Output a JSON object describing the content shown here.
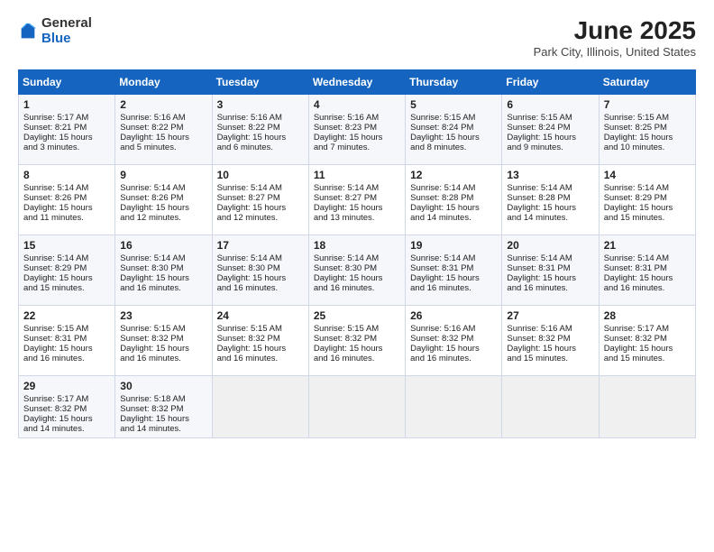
{
  "header": {
    "logo_line1": "General",
    "logo_line2": "Blue",
    "month_title": "June 2025",
    "location": "Park City, Illinois, United States"
  },
  "days_of_week": [
    "Sunday",
    "Monday",
    "Tuesday",
    "Wednesday",
    "Thursday",
    "Friday",
    "Saturday"
  ],
  "weeks": [
    [
      {
        "day": "1",
        "lines": [
          "Sunrise: 5:17 AM",
          "Sunset: 8:21 PM",
          "Daylight: 15 hours",
          "and 3 minutes."
        ]
      },
      {
        "day": "2",
        "lines": [
          "Sunrise: 5:16 AM",
          "Sunset: 8:22 PM",
          "Daylight: 15 hours",
          "and 5 minutes."
        ]
      },
      {
        "day": "3",
        "lines": [
          "Sunrise: 5:16 AM",
          "Sunset: 8:22 PM",
          "Daylight: 15 hours",
          "and 6 minutes."
        ]
      },
      {
        "day": "4",
        "lines": [
          "Sunrise: 5:16 AM",
          "Sunset: 8:23 PM",
          "Daylight: 15 hours",
          "and 7 minutes."
        ]
      },
      {
        "day": "5",
        "lines": [
          "Sunrise: 5:15 AM",
          "Sunset: 8:24 PM",
          "Daylight: 15 hours",
          "and 8 minutes."
        ]
      },
      {
        "day": "6",
        "lines": [
          "Sunrise: 5:15 AM",
          "Sunset: 8:24 PM",
          "Daylight: 15 hours",
          "and 9 minutes."
        ]
      },
      {
        "day": "7",
        "lines": [
          "Sunrise: 5:15 AM",
          "Sunset: 8:25 PM",
          "Daylight: 15 hours",
          "and 10 minutes."
        ]
      }
    ],
    [
      {
        "day": "8",
        "lines": [
          "Sunrise: 5:14 AM",
          "Sunset: 8:26 PM",
          "Daylight: 15 hours",
          "and 11 minutes."
        ]
      },
      {
        "day": "9",
        "lines": [
          "Sunrise: 5:14 AM",
          "Sunset: 8:26 PM",
          "Daylight: 15 hours",
          "and 12 minutes."
        ]
      },
      {
        "day": "10",
        "lines": [
          "Sunrise: 5:14 AM",
          "Sunset: 8:27 PM",
          "Daylight: 15 hours",
          "and 12 minutes."
        ]
      },
      {
        "day": "11",
        "lines": [
          "Sunrise: 5:14 AM",
          "Sunset: 8:27 PM",
          "Daylight: 15 hours",
          "and 13 minutes."
        ]
      },
      {
        "day": "12",
        "lines": [
          "Sunrise: 5:14 AM",
          "Sunset: 8:28 PM",
          "Daylight: 15 hours",
          "and 14 minutes."
        ]
      },
      {
        "day": "13",
        "lines": [
          "Sunrise: 5:14 AM",
          "Sunset: 8:28 PM",
          "Daylight: 15 hours",
          "and 14 minutes."
        ]
      },
      {
        "day": "14",
        "lines": [
          "Sunrise: 5:14 AM",
          "Sunset: 8:29 PM",
          "Daylight: 15 hours",
          "and 15 minutes."
        ]
      }
    ],
    [
      {
        "day": "15",
        "lines": [
          "Sunrise: 5:14 AM",
          "Sunset: 8:29 PM",
          "Daylight: 15 hours",
          "and 15 minutes."
        ]
      },
      {
        "day": "16",
        "lines": [
          "Sunrise: 5:14 AM",
          "Sunset: 8:30 PM",
          "Daylight: 15 hours",
          "and 16 minutes."
        ]
      },
      {
        "day": "17",
        "lines": [
          "Sunrise: 5:14 AM",
          "Sunset: 8:30 PM",
          "Daylight: 15 hours",
          "and 16 minutes."
        ]
      },
      {
        "day": "18",
        "lines": [
          "Sunrise: 5:14 AM",
          "Sunset: 8:30 PM",
          "Daylight: 15 hours",
          "and 16 minutes."
        ]
      },
      {
        "day": "19",
        "lines": [
          "Sunrise: 5:14 AM",
          "Sunset: 8:31 PM",
          "Daylight: 15 hours",
          "and 16 minutes."
        ]
      },
      {
        "day": "20",
        "lines": [
          "Sunrise: 5:14 AM",
          "Sunset: 8:31 PM",
          "Daylight: 15 hours",
          "and 16 minutes."
        ]
      },
      {
        "day": "21",
        "lines": [
          "Sunrise: 5:14 AM",
          "Sunset: 8:31 PM",
          "Daylight: 15 hours",
          "and 16 minutes."
        ]
      }
    ],
    [
      {
        "day": "22",
        "lines": [
          "Sunrise: 5:15 AM",
          "Sunset: 8:31 PM",
          "Daylight: 15 hours",
          "and 16 minutes."
        ]
      },
      {
        "day": "23",
        "lines": [
          "Sunrise: 5:15 AM",
          "Sunset: 8:32 PM",
          "Daylight: 15 hours",
          "and 16 minutes."
        ]
      },
      {
        "day": "24",
        "lines": [
          "Sunrise: 5:15 AM",
          "Sunset: 8:32 PM",
          "Daylight: 15 hours",
          "and 16 minutes."
        ]
      },
      {
        "day": "25",
        "lines": [
          "Sunrise: 5:15 AM",
          "Sunset: 8:32 PM",
          "Daylight: 15 hours",
          "and 16 minutes."
        ]
      },
      {
        "day": "26",
        "lines": [
          "Sunrise: 5:16 AM",
          "Sunset: 8:32 PM",
          "Daylight: 15 hours",
          "and 16 minutes."
        ]
      },
      {
        "day": "27",
        "lines": [
          "Sunrise: 5:16 AM",
          "Sunset: 8:32 PM",
          "Daylight: 15 hours",
          "and 15 minutes."
        ]
      },
      {
        "day": "28",
        "lines": [
          "Sunrise: 5:17 AM",
          "Sunset: 8:32 PM",
          "Daylight: 15 hours",
          "and 15 minutes."
        ]
      }
    ],
    [
      {
        "day": "29",
        "lines": [
          "Sunrise: 5:17 AM",
          "Sunset: 8:32 PM",
          "Daylight: 15 hours",
          "and 14 minutes."
        ]
      },
      {
        "day": "30",
        "lines": [
          "Sunrise: 5:18 AM",
          "Sunset: 8:32 PM",
          "Daylight: 15 hours",
          "and 14 minutes."
        ]
      },
      null,
      null,
      null,
      null,
      null
    ]
  ]
}
